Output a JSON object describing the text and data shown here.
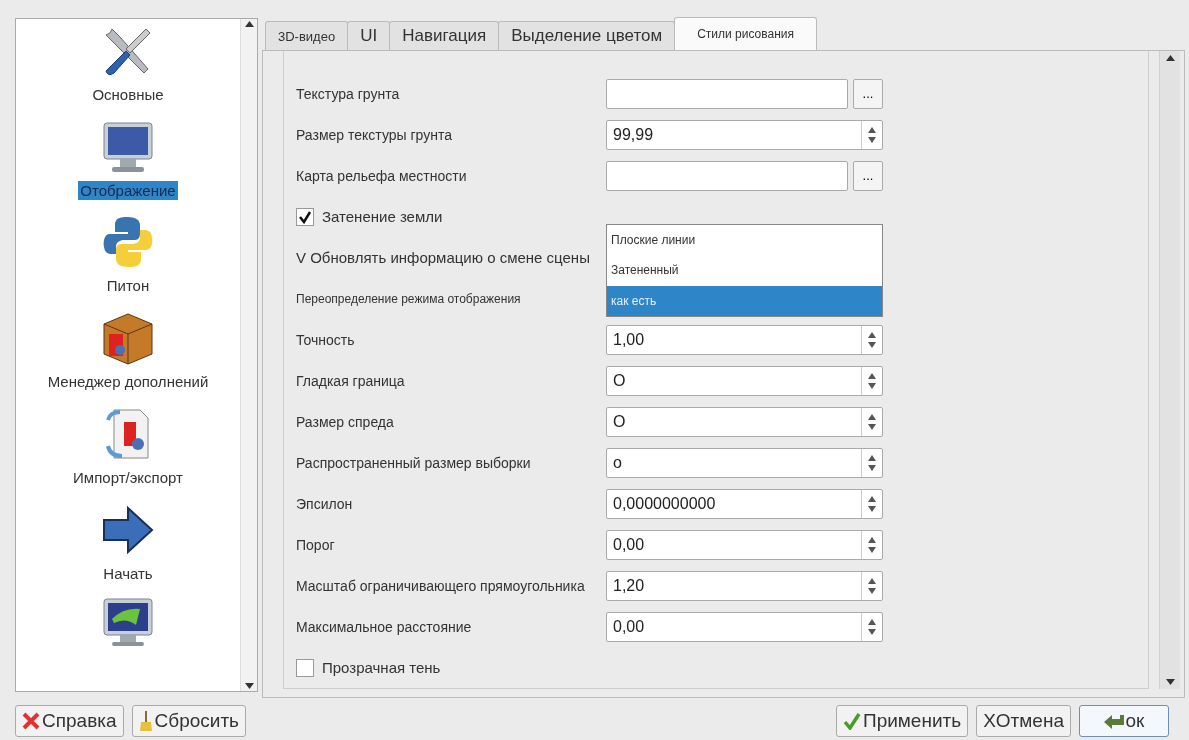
{
  "sidebar": {
    "items": [
      {
        "label": "Основные",
        "selected": false
      },
      {
        "label": "Отображение",
        "selected": true
      },
      {
        "label": "Питон",
        "selected": false
      },
      {
        "label": "Менеджер дополнений",
        "selected": false
      },
      {
        "label": "Импорт/экспорт",
        "selected": false
      },
      {
        "label": "Начать",
        "selected": false
      }
    ]
  },
  "tabs": [
    {
      "label": "3D-видео",
      "selected": false
    },
    {
      "label": "UI",
      "selected": false
    },
    {
      "label": "Навигация",
      "selected": false
    },
    {
      "label": "Выделение цветом",
      "selected": false
    },
    {
      "label": "Стили рисования",
      "selected": true
    }
  ],
  "settings": [
    {
      "kind": "file",
      "label": "Текстура грунта"
    },
    {
      "kind": "spin",
      "label": "Размер текстуры грунта",
      "value": "99,99"
    },
    {
      "kind": "file",
      "label": "Карта рельефа местности"
    },
    {
      "kind": "check",
      "label": "Затенение земли",
      "checked": true
    },
    {
      "kind": "text",
      "label": "V Обновлять информацию о смене сцены"
    },
    {
      "kind": "dropdown",
      "label": "Переопределение режима отображения",
      "options": [
        {
          "label": "Плоские линии",
          "selected": false
        },
        {
          "label": "Затененный",
          "selected": false
        },
        {
          "label": "как есть",
          "selected": true
        }
      ]
    },
    {
      "kind": "spin",
      "label": "Точность",
      "value": "1,00"
    },
    {
      "kind": "spin",
      "label": "Гладкая граница",
      "value": "O"
    },
    {
      "kind": "spin",
      "label": "Размер спреда",
      "value": "O"
    },
    {
      "kind": "spin",
      "label": "Распространенный размер выборки",
      "value": "o"
    },
    {
      "kind": "spin",
      "label": "Эпсилон",
      "value": "0,0000000000"
    },
    {
      "kind": "spin",
      "label": "Порог",
      "value": "0,00"
    },
    {
      "kind": "spin",
      "label": "Масштаб ограничивающего прямоугольника",
      "value": "1,20"
    },
    {
      "kind": "spin",
      "label": "Максимальное расстояние",
      "value": "0,00"
    },
    {
      "kind": "check",
      "label": "Прозрачная тень",
      "checked": false
    }
  ],
  "browse_label": "...",
  "left_buttons": [
    {
      "label": "Справка"
    },
    {
      "label": "Сбросить"
    }
  ],
  "right_buttons": [
    {
      "label": "Применить",
      "default": false
    },
    {
      "label": "XОтмена",
      "default": false
    },
    {
      "label": "ок",
      "default": true
    }
  ]
}
